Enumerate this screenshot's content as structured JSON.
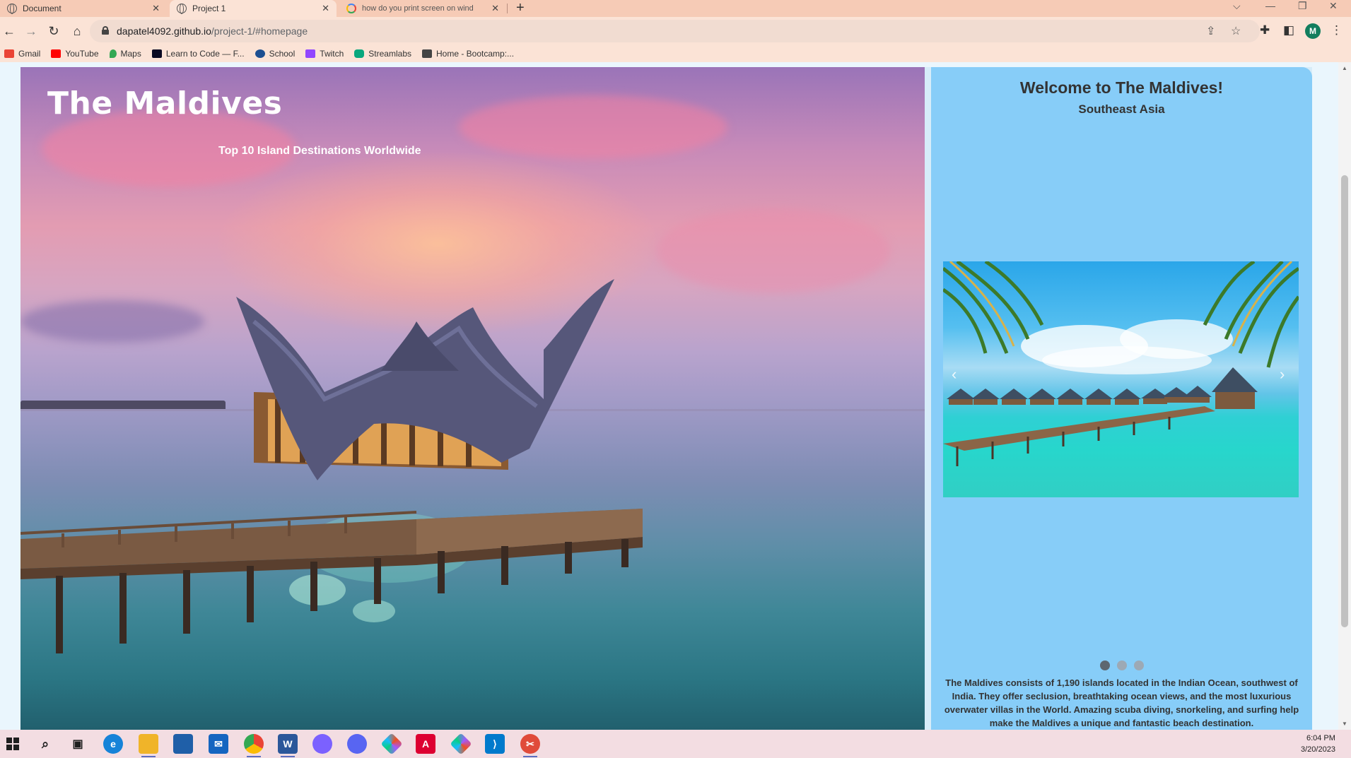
{
  "browser": {
    "tabs": [
      {
        "title": "Document",
        "icon": "globe-icon",
        "active": false
      },
      {
        "title": "Project 1",
        "icon": "globe-icon",
        "active": true
      },
      {
        "title": "how do you print screen on wind",
        "icon": "google-icon",
        "active": false
      }
    ],
    "url_host": "dapatel4092.github.io",
    "url_path": "/project-1/#homepage",
    "profile_initial": "M",
    "bookmarks": [
      {
        "label": "Gmail",
        "icon": "gmail-icon",
        "color": "#ea4335"
      },
      {
        "label": "YouTube",
        "icon": "youtube-icon",
        "color": "#ff0000"
      },
      {
        "label": "Maps",
        "icon": "maps-icon",
        "color": "#34a853"
      },
      {
        "label": "Learn to Code — F...",
        "icon": "freecodecamp-icon",
        "color": "#0a0a23"
      },
      {
        "label": "School",
        "icon": "school-icon",
        "color": "#1d4f91"
      },
      {
        "label": "Twitch",
        "icon": "twitch-icon",
        "color": "#9146ff"
      },
      {
        "label": "Streamlabs",
        "icon": "streamlabs-icon",
        "color": "#09a77d"
      },
      {
        "label": "Home - Bootcamp:...",
        "icon": "bootcamp-icon",
        "color": "#444444"
      }
    ]
  },
  "hero": {
    "title": "The Maldives",
    "subtitle": "Top 10 Island Destinations Worldwide"
  },
  "sidebar": {
    "welcome": "Welcome to The Maldives!",
    "region": "Southeast Asia",
    "carousel": {
      "slides": 3,
      "active_slide": 1
    },
    "description": "The Maldives consists of 1,190 islands located in the Indian Ocean, southwest of India. They offer seclusion, breathtaking ocean views, and the most luxurious overwater villas in the World. Amazing scuba diving, snorkeling, and surfing help make the Maldives a unique and fantastic beach destination."
  },
  "taskbar": {
    "apps": [
      {
        "name": "start-icon",
        "color": "#1f1f1f"
      },
      {
        "name": "search-icon",
        "color": "#1f1f1f"
      },
      {
        "name": "task-view-icon",
        "color": "#1f1f1f"
      },
      {
        "name": "edge-icon",
        "color": "#1683d8"
      },
      {
        "name": "file-explorer-icon",
        "color": "#f0b429"
      },
      {
        "name": "store-icon",
        "color": "#1f5fa8"
      },
      {
        "name": "mail-icon",
        "color": "#1565c0"
      },
      {
        "name": "chrome-icon",
        "color": "#34a853"
      },
      {
        "name": "word-icon",
        "color": "#2b579a"
      },
      {
        "name": "photos-icon",
        "color": "#7b61ff"
      },
      {
        "name": "discord-icon",
        "color": "#5865f2"
      },
      {
        "name": "figma-icon",
        "color": "#f24e1e"
      },
      {
        "name": "angular-icon",
        "color": "#dd0031"
      },
      {
        "name": "figma-icon-2",
        "color": "#a259ff"
      },
      {
        "name": "vscode-icon",
        "color": "#007acc"
      },
      {
        "name": "snipping-tool-icon",
        "color": "#e04b3a"
      }
    ],
    "time": "6:04 PM",
    "date": "3/20/2023"
  }
}
